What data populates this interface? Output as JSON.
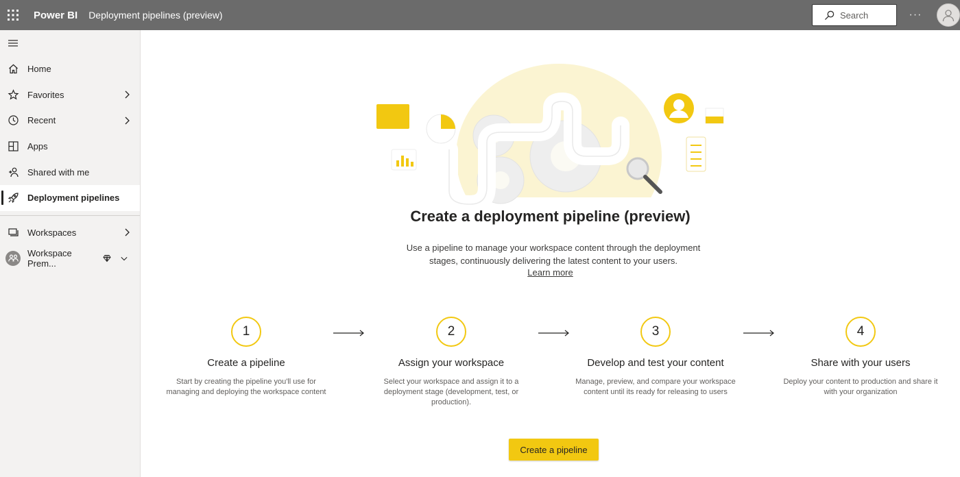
{
  "topbar": {
    "app_name": "Power BI",
    "breadcrumb": "Deployment pipelines (preview)",
    "search_placeholder": "Search",
    "more_label": "···"
  },
  "sidebar": {
    "items": [
      {
        "label": "Home",
        "icon": "home-icon"
      },
      {
        "label": "Favorites",
        "icon": "star-icon"
      },
      {
        "label": "Recent",
        "icon": "clock-icon"
      },
      {
        "label": "Apps",
        "icon": "apps-icon"
      },
      {
        "label": "Shared with me",
        "icon": "shared-icon"
      },
      {
        "label": "Deployment pipelines",
        "icon": "rocket-icon"
      }
    ],
    "workspaces_label": "Workspaces",
    "workspace_label": "Workspace Prem..."
  },
  "main": {
    "title": "Create a deployment pipeline (preview)",
    "description": "Use a pipeline to manage your workspace content through the deployment stages, continuously delivering the latest content to your users.",
    "learn_more": "Learn more",
    "steps": [
      {
        "number": "1",
        "title": "Create a pipeline",
        "description": "Start by creating the pipeline you'll use for managing and deploying the workspace content"
      },
      {
        "number": "2",
        "title": "Assign your workspace",
        "description": "Select your workspace and assign it to a deployment stage (development, test, or production)."
      },
      {
        "number": "3",
        "title": "Develop and test your content",
        "description": "Manage, preview, and compare your workspace content until its ready for releasing to users"
      },
      {
        "number": "4",
        "title": "Share with your users",
        "description": "Deploy your content to production and share it with your organization"
      }
    ],
    "cta_label": "Create a pipeline"
  },
  "colors": {
    "topbar": "#6b6b6b",
    "accent": "#f2c811",
    "sidebar_bg": "#f3f2f1"
  }
}
